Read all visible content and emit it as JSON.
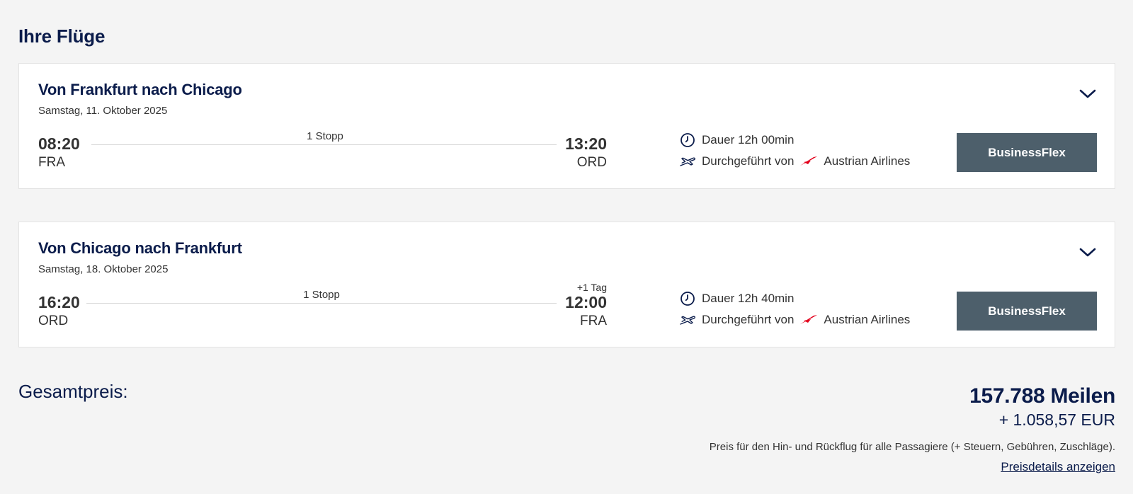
{
  "page": {
    "title": "Ihre Flüge"
  },
  "flights": [
    {
      "route_title": "Von Frankfurt nach Chicago",
      "date": "Samstag, 11. Oktober 2025",
      "departure_time": "08:20",
      "departure_airport": "FRA",
      "stops": "1 Stopp",
      "arrival_time": "13:20",
      "arrival_airport": "ORD",
      "arrival_day_offset": "",
      "duration": "Dauer 12h 00min",
      "operated_by": "Durchgeführt von",
      "airline": "Austrian Airlines",
      "fare_line_1": "Business",
      "fare_line_2": "Flex"
    },
    {
      "route_title": "Von Chicago nach Frankfurt",
      "date": "Samstag, 18. Oktober 2025",
      "departure_time": "16:20",
      "departure_airport": "ORD",
      "stops": "1 Stopp",
      "arrival_time": "12:00",
      "arrival_airport": "FRA",
      "arrival_day_offset": "+1 Tag",
      "duration": "Dauer 12h 40min",
      "operated_by": "Durchgeführt von",
      "airline": "Austrian Airlines",
      "fare_line_1": "Business",
      "fare_line_2": "Flex"
    }
  ],
  "summary": {
    "label": "Gesamtpreis:",
    "miles": "157.788 Meilen",
    "money": "+ 1.058,57 EUR",
    "note": "Preis für den Hin- und Rückflug für alle Passagiere (+ Steuern, Gebühren, Zuschläge).",
    "details_link": "Preisdetails anzeigen"
  },
  "icons": {
    "chevron": "chevron-down-icon",
    "clock": "clock-icon",
    "plane": "plane-icon",
    "airline_logo": "austrian-airlines-logo"
  },
  "colors": {
    "navy": "#0b1c4b",
    "fare_button": "#4d5f6b",
    "logo_red": "#e3001b"
  }
}
